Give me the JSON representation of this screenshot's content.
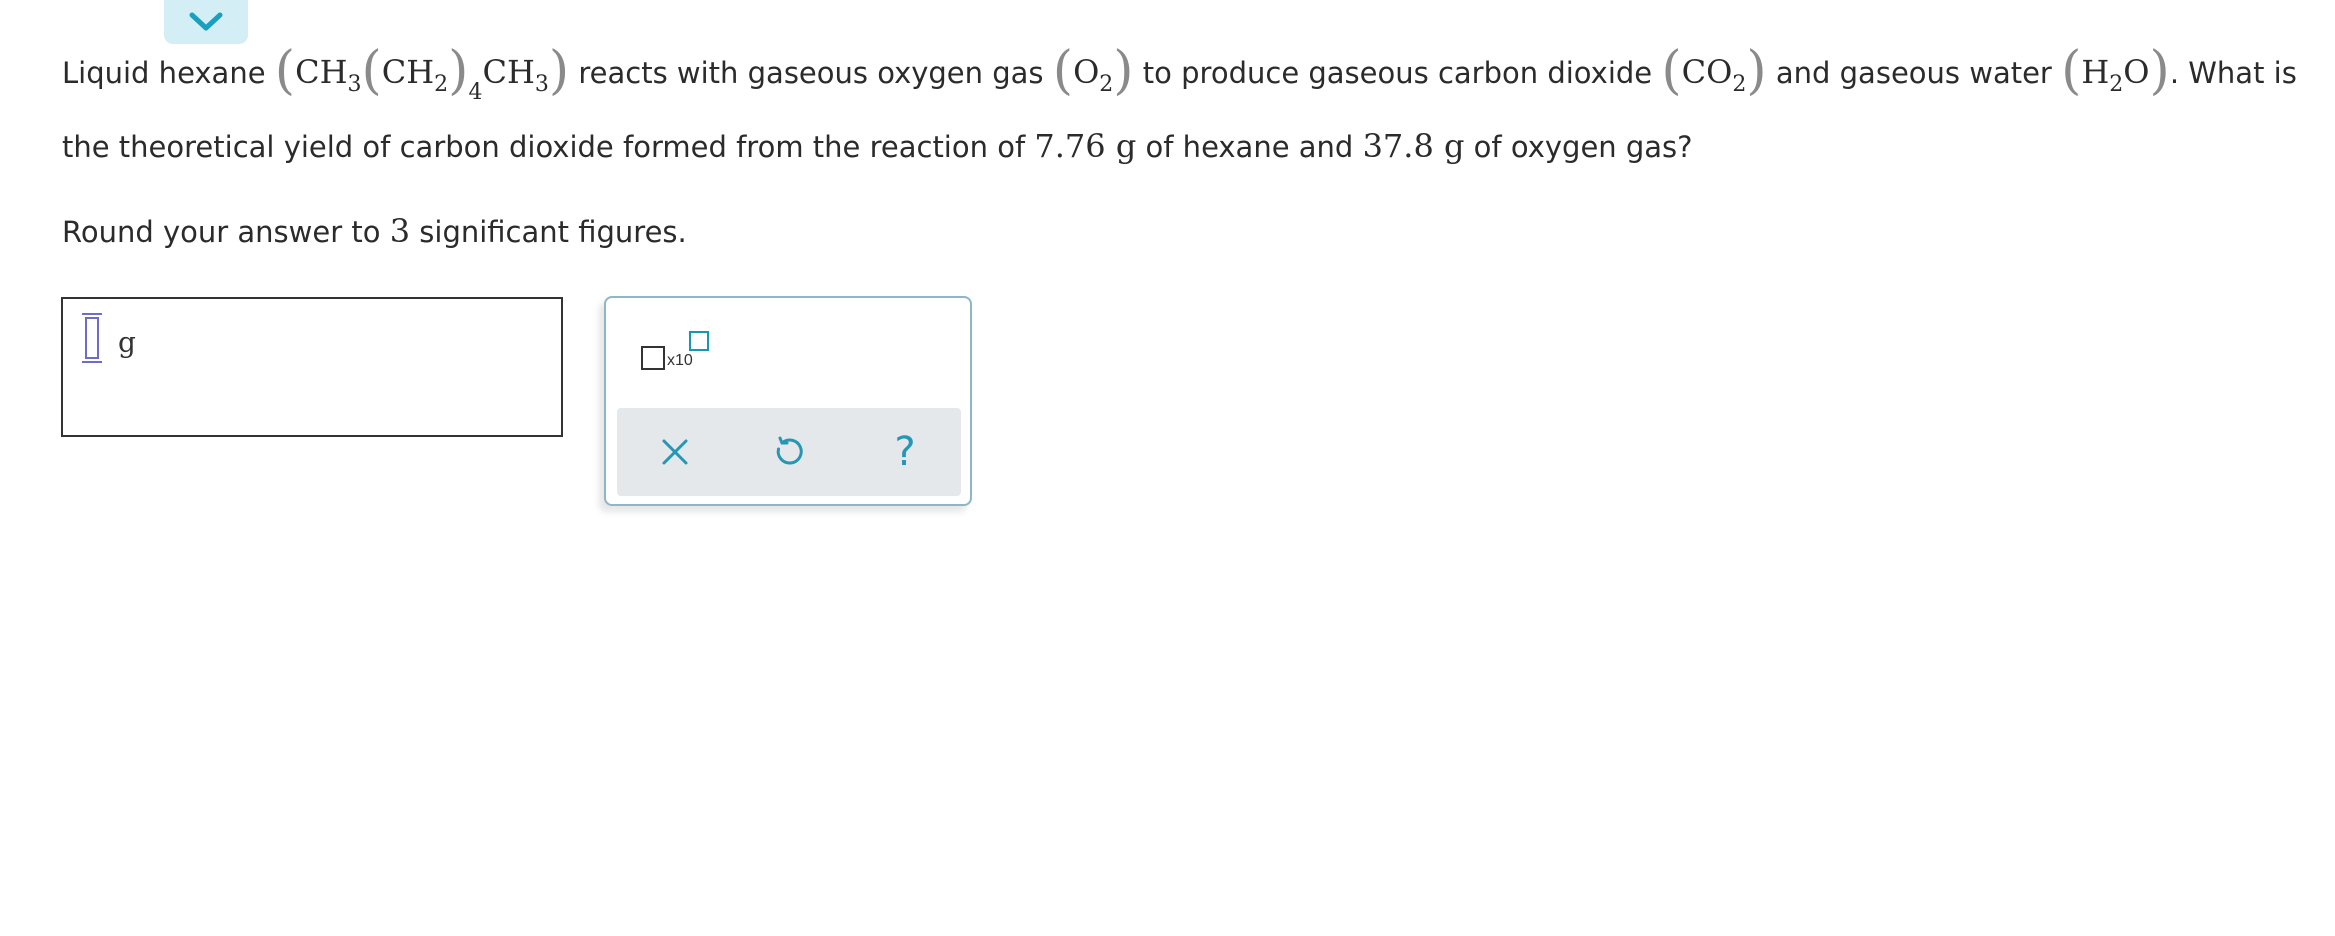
{
  "collapse_toggle": {
    "icon": "chevron-down-icon",
    "color": "#1a9fc0"
  },
  "question": {
    "p1": "Liquid hexane ",
    "hexane_ch3a": "CH",
    "hexane_sub3a": "3",
    "hexane_ch2": "CH",
    "hexane_sub2": "2",
    "hexane_sub4": "4",
    "hexane_ch3b": "CH",
    "hexane_sub3b": "3",
    "p2": " reacts with gaseous oxygen gas ",
    "o2": "O",
    "o2_sub": "2",
    "p3": " to produce gaseous carbon dioxide ",
    "co2": "CO",
    "co2_sub": "2",
    "p4": " and gaseous water ",
    "h2o_h": "H",
    "h2o_sub": "2",
    "h2o_o": "O",
    "p5": ". What is the theoretical yield of carbon dioxide formed from the reaction of ",
    "hexane_mass": "7.76 g",
    "p6": " of hexane and ",
    "oxygen_mass": "37.8 g",
    "p7": " of oxygen gas?"
  },
  "rounding": {
    "before": "Round your answer to ",
    "sig_figs": "3",
    "after": " significant figures."
  },
  "answer": {
    "value": "",
    "unit": "g"
  },
  "toolbox": {
    "sci_label": "x10",
    "clear_icon": "close-icon",
    "reset_icon": "undo-icon",
    "help_label": "?",
    "accent": "#2596b5"
  }
}
